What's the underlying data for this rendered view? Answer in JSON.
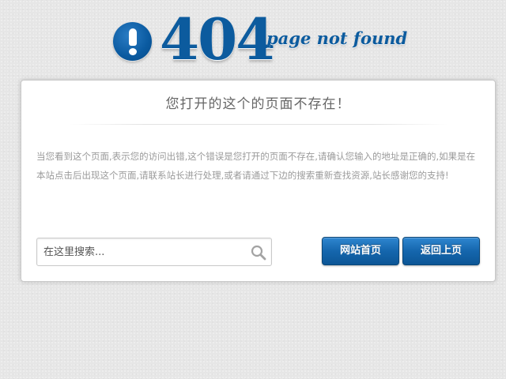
{
  "header": {
    "alert_icon": "exclamation-circle-icon",
    "code": "404",
    "tagline": "page not found",
    "accent_color": "#0c5b9e"
  },
  "panel": {
    "title": "您打开的这个的页面不存在！",
    "message": "当您看到这个页面,表示您的访问出错,这个错误是您打开的页面不存在,请确认您输入的地址是正确的,如果是在本站点击后出现这个页面,请联系站长进行处理,或者请通过下边的搜索重新查找资源,站长感谢您的支持!"
  },
  "search": {
    "placeholder": "在这里搜索...",
    "value": "",
    "icon": "search-icon"
  },
  "buttons": {
    "home_label": "网站首页",
    "back_label": "返回上页",
    "color": "#1566ad"
  }
}
